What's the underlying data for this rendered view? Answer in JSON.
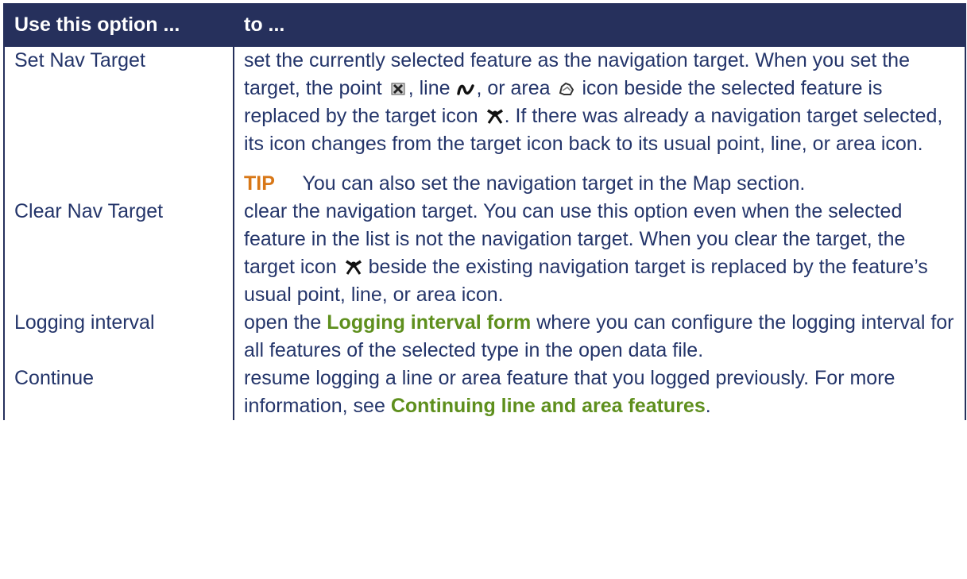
{
  "header": {
    "col1": "Use this option ...",
    "col2": "to ..."
  },
  "rows": [
    {
      "option": "Set Nav Target",
      "p1": "set the currently selected feature as the navigation target. When you set the target, the point",
      "p2": ", line",
      "p3": ", or area",
      "p4": "icon beside the selected feature is replaced by the target icon",
      "p5": ". If there was already a navigation target selected, its icon changes from the target icon back to its usual point, line, or area icon.",
      "tip_label": "TIP",
      "tip_text": "You can also set the navigation target in the Map section."
    },
    {
      "option": "Clear Nav Target",
      "p1": "clear the navigation target. You can use this option even when the selected feature in the list is not the navigation target. When you clear the target, the target icon",
      "p2": "beside the existing navigation target is replaced by the feature’s usual point, line, or area icon."
    },
    {
      "option": "Logging interval",
      "p1": "open the",
      "link": "Logging interval form",
      "p2": "where you can configure the logging interval for all features of the selected type in the open data file."
    },
    {
      "option": "Continue",
      "p1": "resume logging a line or area feature that you logged previously. For more information, see",
      "link": "Continuing line and area features",
      "p2": "."
    }
  ],
  "icons": {
    "point": "point-feature-icon",
    "line": "line-feature-icon",
    "area": "area-feature-icon",
    "target": "nav-target-icon"
  },
  "colors": {
    "header_bg": "#26305c",
    "body_text": "#24356a",
    "link": "#5e8f1d",
    "tip": "#d87717"
  }
}
